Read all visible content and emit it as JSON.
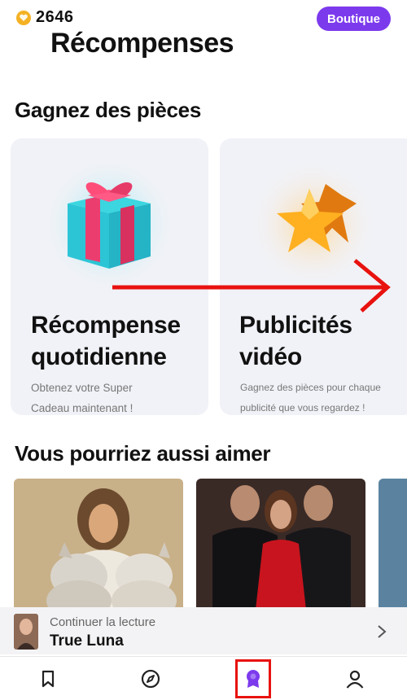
{
  "header": {
    "coin_icon": "coin-icon",
    "coin_count": "2646",
    "shop_button": "Boutique",
    "title": "Récompenses"
  },
  "earn_section": {
    "title": "Gagnez des pièces",
    "cards": [
      {
        "icon": "gift-icon",
        "title_line1": "Récompense",
        "title_line2": "quotidienne",
        "desc_line1": "Obtenez votre Super",
        "desc_line2": "Cadeau maintenant !"
      },
      {
        "icon": "star-icon",
        "title_line1": "Publicités",
        "title_line2": "vidéo",
        "desc_line1": "Gagnez des pièces pour chaque",
        "desc_line2": "publicité que vous regardez !"
      }
    ]
  },
  "recommend_section": {
    "title": "Vous pourriez aussi aimer"
  },
  "continue_reading": {
    "label": "Continuer la lecture",
    "title": "True Luna"
  },
  "bottom_nav": [
    "bookmark-icon",
    "compass-icon",
    "rewards-icon",
    "profile-icon"
  ],
  "colors": {
    "accent": "#7c3aed",
    "coin": "#f4b223",
    "annotation": "#e8120f"
  }
}
